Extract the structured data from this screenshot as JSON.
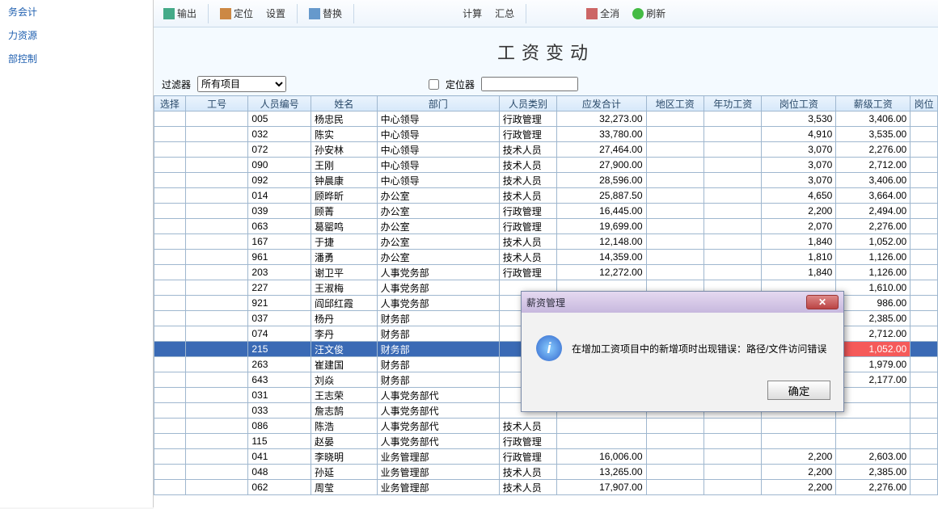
{
  "sidebar": {
    "items": [
      {
        "label": "务会计"
      },
      {
        "label": "力资源"
      },
      {
        "label": "部控制"
      }
    ]
  },
  "toolbar": {
    "export": "输出",
    "locate": "定位",
    "settings": "设置",
    "replace": "替换",
    "calc": "计算",
    "summary": "汇总",
    "clear": "全消",
    "refresh": "刷新"
  },
  "title": "工资变动",
  "filter": {
    "label": "过滤器",
    "dropdown": "所有项目",
    "locator_label": "定位器",
    "locator_value": ""
  },
  "columns": {
    "select": "选择",
    "id": "工号",
    "person_no": "人员编号",
    "name": "姓名",
    "dept": "部门",
    "category": "人员类别",
    "total": "应发合计",
    "region": "地区工资",
    "year": "年功工资",
    "post": "岗位工资",
    "grade": "薪级工资",
    "last": "岗位"
  },
  "rows": [
    {
      "pno": "005",
      "name": "杨忠民",
      "dept": "中心领导",
      "cat": "行政管理",
      "total": "32,273.00",
      "post": "3,530",
      "grade": "3,406.00"
    },
    {
      "pno": "032",
      "name": "陈实",
      "dept": "中心领导",
      "cat": "行政管理",
      "total": "33,780.00",
      "post": "4,910",
      "grade": "3,535.00"
    },
    {
      "pno": "072",
      "name": "孙安林",
      "dept": "中心领导",
      "cat": "技术人员",
      "total": "27,464.00",
      "post": "3,070",
      "grade": "2,276.00"
    },
    {
      "pno": "090",
      "name": "王刚",
      "dept": "中心领导",
      "cat": "技术人员",
      "total": "27,900.00",
      "post": "3,070",
      "grade": "2,712.00"
    },
    {
      "pno": "092",
      "name": "钟晨康",
      "dept": "中心领导",
      "cat": "技术人员",
      "total": "28,596.00",
      "post": "3,070",
      "grade": "3,406.00"
    },
    {
      "pno": "014",
      "name": "顾晔昕",
      "dept": "办公室",
      "cat": "技术人员",
      "total": "25,887.50",
      "post": "4,650",
      "grade": "3,664.00"
    },
    {
      "pno": "039",
      "name": "顾菁",
      "dept": "办公室",
      "cat": "行政管理",
      "total": "16,445.00",
      "post": "2,200",
      "grade": "2,494.00"
    },
    {
      "pno": "063",
      "name": "葛罂鸣",
      "dept": "办公室",
      "cat": "行政管理",
      "total": "19,699.00",
      "post": "2,070",
      "grade": "2,276.00"
    },
    {
      "pno": "167",
      "name": "于捷",
      "dept": "办公室",
      "cat": "技术人员",
      "total": "12,148.00",
      "post": "1,840",
      "grade": "1,052.00"
    },
    {
      "pno": "961",
      "name": "潘勇",
      "dept": "办公室",
      "cat": "技术人员",
      "total": "14,359.00",
      "post": "1,810",
      "grade": "1,126.00"
    },
    {
      "pno": "203",
      "name": "谢卫平",
      "dept": "人事党务部",
      "cat": "行政管理",
      "total": "12,272.00",
      "post": "1,840",
      "grade": "1,126.00"
    },
    {
      "pno": "227",
      "name": "王淑梅",
      "dept": "人事党务部",
      "cat": "",
      "total": "",
      "post": "",
      "grade": "1,610.00"
    },
    {
      "pno": "921",
      "name": "阎邱红霞",
      "dept": "人事党务部",
      "cat": "",
      "total": "",
      "post": "",
      "grade": "986.00"
    },
    {
      "pno": "037",
      "name": "杨丹",
      "dept": "财务部",
      "cat": "",
      "total": "",
      "post": "",
      "grade": "2,385.00"
    },
    {
      "pno": "074",
      "name": "李丹",
      "dept": "财务部",
      "cat": "",
      "total": "",
      "post": "",
      "grade": "2,712.00"
    },
    {
      "pno": "215",
      "name": "汪文俊",
      "dept": "财务部",
      "cat": "",
      "total": "",
      "post": "",
      "grade": "1,052.00",
      "selected": true
    },
    {
      "pno": "263",
      "name": "崔建国",
      "dept": "财务部",
      "cat": "",
      "total": "",
      "post": "",
      "grade": "1,979.00"
    },
    {
      "pno": "643",
      "name": "刘焱",
      "dept": "财务部",
      "cat": "",
      "total": "",
      "post": "",
      "grade": "2,177.00"
    },
    {
      "pno": "031",
      "name": "王志荣",
      "dept": "人事党务部代",
      "cat": "",
      "total": "",
      "post": "",
      "grade": ""
    },
    {
      "pno": "033",
      "name": "詹志鹄",
      "dept": "人事党务部代",
      "cat": "",
      "total": "",
      "post": "",
      "grade": ""
    },
    {
      "pno": "086",
      "name": "陈浩",
      "dept": "人事党务部代",
      "cat": "技术人员",
      "total": "",
      "post": "",
      "grade": ""
    },
    {
      "pno": "115",
      "name": "赵晏",
      "dept": "人事党务部代",
      "cat": "行政管理",
      "total": "",
      "post": "",
      "grade": ""
    },
    {
      "pno": "041",
      "name": "李晓明",
      "dept": "业务管理部",
      "cat": "行政管理",
      "total": "16,006.00",
      "post": "2,200",
      "grade": "2,603.00"
    },
    {
      "pno": "048",
      "name": "孙延",
      "dept": "业务管理部",
      "cat": "技术人员",
      "total": "13,265.00",
      "post": "2,200",
      "grade": "2,385.00"
    },
    {
      "pno": "062",
      "name": "周莹",
      "dept": "业务管理部",
      "cat": "技术人员",
      "total": "17,907.00",
      "post": "2,200",
      "grade": "2,276.00"
    }
  ],
  "dialog": {
    "title": "薪资管理",
    "message": "在增加工资项目中的新增项时出现错误：路径/文件访问错误",
    "ok": "确定",
    "close": "✕"
  }
}
